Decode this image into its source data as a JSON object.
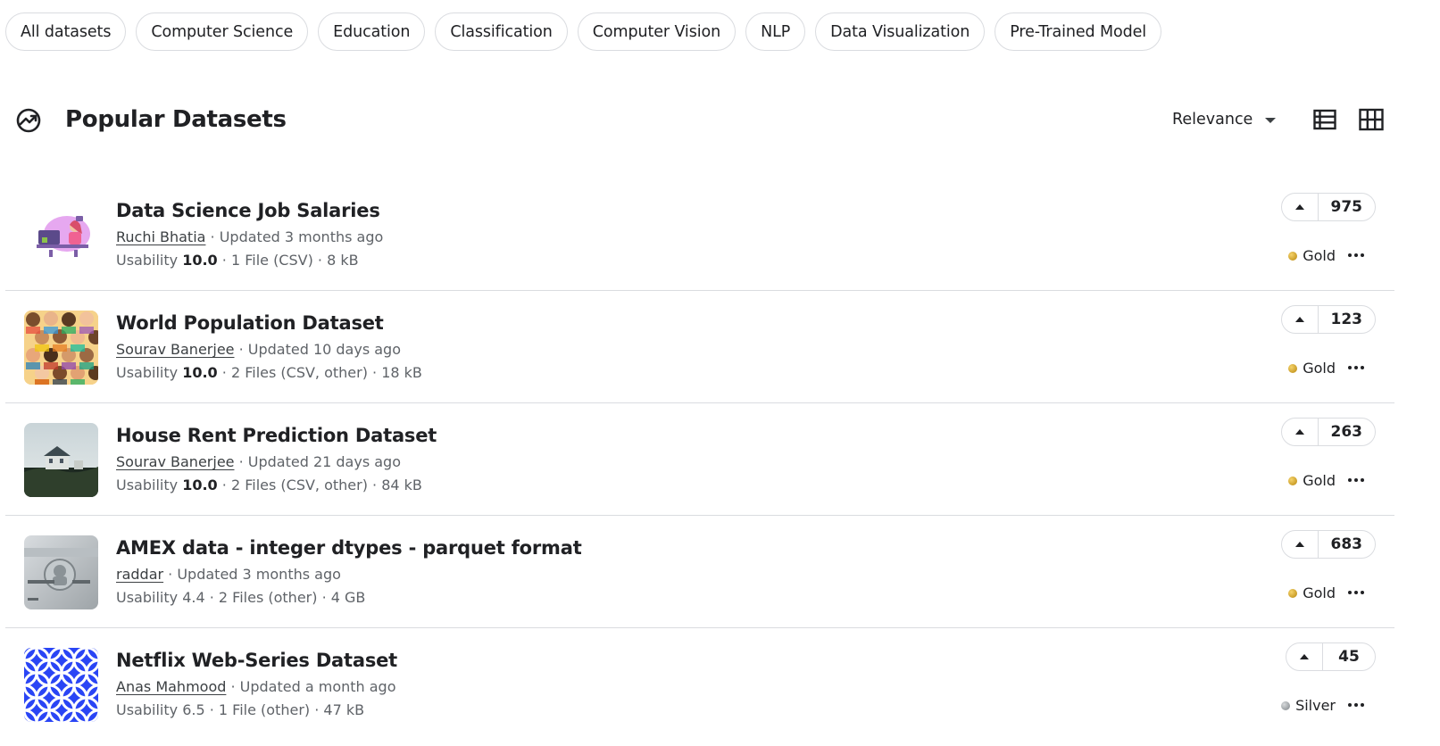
{
  "chips": [
    "All datasets",
    "Computer Science",
    "Education",
    "Classification",
    "Computer Vision",
    "NLP",
    "Data Visualization",
    "Pre-Trained Model"
  ],
  "header": {
    "title": "Popular Datasets",
    "sort_label": "Relevance"
  },
  "datasets": [
    {
      "title": "Data Science Job Salaries",
      "author": "Ruchi Bhatia",
      "updated": "· Updated 3 months ago",
      "usability_label": "Usability",
      "usability": "10.0",
      "files": "· 1 File (CSV) · 8 kB",
      "votes": "975",
      "medal": "Gold",
      "medal_color": "#c9a227"
    },
    {
      "title": "World Population Dataset",
      "author": "Sourav Banerjee",
      "updated": "· Updated 10 days ago",
      "usability_label": "Usability",
      "usability": "10.0",
      "files": "· 2 Files (CSV, other) · 18 kB",
      "votes": "123",
      "medal": "Gold",
      "medal_color": "#c9a227"
    },
    {
      "title": "House Rent Prediction Dataset",
      "author": "Sourav Banerjee",
      "updated": "· Updated 21 days ago",
      "usability_label": "Usability",
      "usability": "10.0",
      "files": "· 2 Files (CSV, other) · 84 kB",
      "votes": "263",
      "medal": "Gold",
      "medal_color": "#c9a227"
    },
    {
      "title": "AMEX data - integer dtypes - parquet format",
      "author": "raddar",
      "updated": "· Updated 3 months ago",
      "usability_label": "Usability",
      "usability": "4.4",
      "files": "· 2 Files (other) · 4 GB",
      "votes": "683",
      "medal": "Gold",
      "medal_color": "#c9a227"
    },
    {
      "title": "Netflix Web-Series Dataset",
      "author": "Anas Mahmood",
      "updated": "· Updated a month ago",
      "usability_label": "Usability",
      "usability": "6.5",
      "files": "· 1 File (other) · 47 kB",
      "votes": "45",
      "medal": "Silver",
      "medal_color": "#9aa0a6"
    }
  ]
}
